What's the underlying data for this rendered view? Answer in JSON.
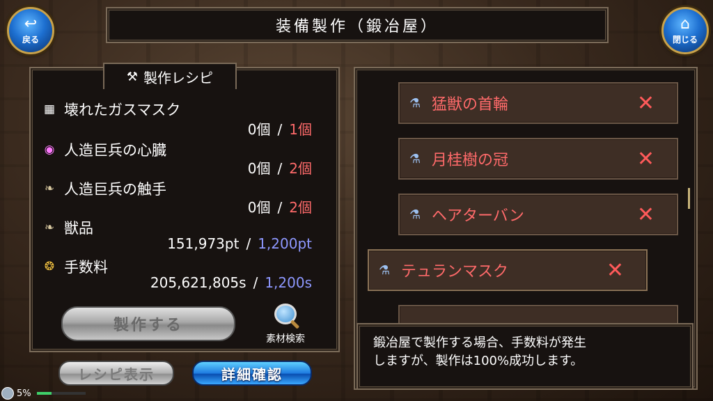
{
  "header": {
    "title": "装備製作（鍛冶屋）"
  },
  "nav": {
    "back_label": "戻る",
    "close_label": "閉じる"
  },
  "recipe": {
    "tab_label": "製作レシピ",
    "materials": [
      {
        "name": "壊れたガスマスク",
        "icon": "gas-mask-icon",
        "have": "0個",
        "need": "1個"
      },
      {
        "name": "人造巨兵の心臓",
        "icon": "heart-orb-icon",
        "have": "0個",
        "need": "2個"
      },
      {
        "name": "人造巨兵の触手",
        "icon": "tentacle-icon",
        "have": "0個",
        "need": "2個"
      },
      {
        "name": "獣品",
        "icon": "fang-icon",
        "have": "151,973pt",
        "need": "1,200pt"
      },
      {
        "name": "手数料",
        "icon": "coin-icon",
        "have": "205,621,805s",
        "need": "1,200s"
      }
    ],
    "separator": "/",
    "make_button": "製作する",
    "search_label": "素材検索",
    "recipe_show_button": "レシピ表示",
    "detail_button": "詳細確認"
  },
  "status": {
    "percent": "5%",
    "fill": 0.3
  },
  "list": {
    "items": [
      {
        "name": "猛獣の首輪"
      },
      {
        "name": "月桂樹の冠"
      },
      {
        "name": "ヘアターバン"
      },
      {
        "name": "テュランマスク"
      }
    ],
    "x_glyph": "✕"
  },
  "message": {
    "line1": "鍛冶屋で製作する場合、手数料が発生",
    "line2": "しますが、製作は100%成功します。"
  },
  "colors": {
    "need": "#ff6a6a",
    "need_blue": "#8e98ff",
    "accent": "#1f7ce0"
  }
}
